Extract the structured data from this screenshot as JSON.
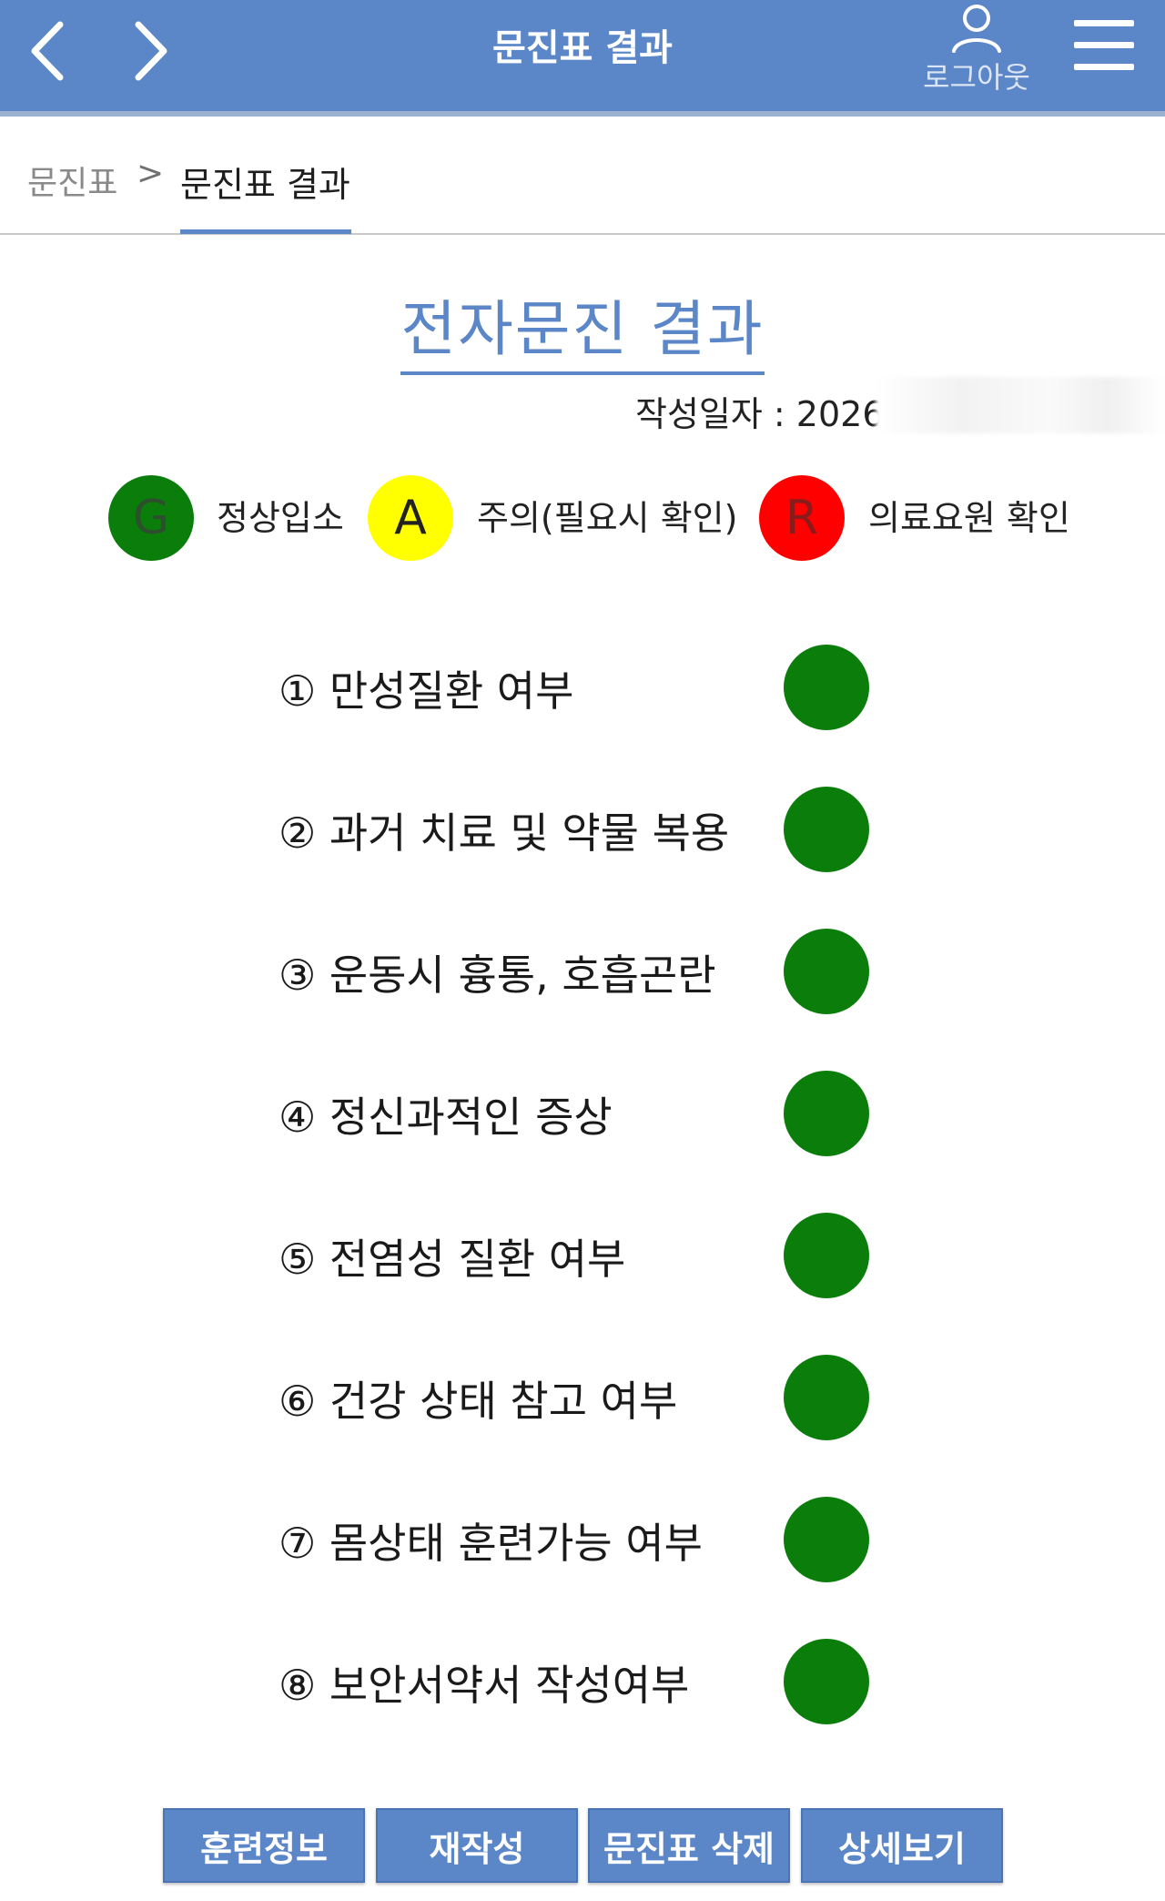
{
  "header": {
    "title": "문진표 결과",
    "logout_label": "로그아웃"
  },
  "breadcrumb": {
    "parent": "문진표",
    "separator": ">",
    "current": "문진표 결과"
  },
  "main": {
    "title": "전자문진 결과",
    "date_label": "작성일자 : 2026"
  },
  "legend": [
    {
      "letter": "G",
      "label": "정상입소",
      "color": "#0b7d0b",
      "text_color": "#2d4f2d"
    },
    {
      "letter": "A",
      "label": "주의(필요시 확인)",
      "color": "#ffff00",
      "text_color": "#222222"
    },
    {
      "letter": "R",
      "label": "의료요원 확인",
      "color": "#ff0000",
      "text_color": "#8a1b1b"
    }
  ],
  "items": [
    {
      "label": "① 만성질환 여부",
      "status": "G",
      "color": "#0b7d0b"
    },
    {
      "label": "② 과거 치료 및 약물 복용",
      "status": "G",
      "color": "#0b7d0b"
    },
    {
      "label": "③ 운동시 흉통, 호흡곤란",
      "status": "G",
      "color": "#0b7d0b"
    },
    {
      "label": "④ 정신과적인 증상",
      "status": "G",
      "color": "#0b7d0b"
    },
    {
      "label": "⑤ 전염성 질환 여부",
      "status": "G",
      "color": "#0b7d0b"
    },
    {
      "label": "⑥ 건강 상태 참고 여부",
      "status": "G",
      "color": "#0b7d0b"
    },
    {
      "label": "⑦ 몸상태 훈련가능 여부",
      "status": "G",
      "color": "#0b7d0b"
    },
    {
      "label": "⑧ 보안서약서 작성여부",
      "status": "G",
      "color": "#0b7d0b"
    }
  ],
  "buttons": {
    "training_info": "훈련정보",
    "rewrite": "재작성",
    "delete": "문진표 삭제",
    "detail": "상세보기"
  },
  "colors": {
    "accent": "#5b86c7",
    "status_green": "#0b7d0b"
  },
  "icons": [
    "chevron-left-icon",
    "chevron-right-icon",
    "user-icon",
    "hamburger-menu-icon"
  ]
}
